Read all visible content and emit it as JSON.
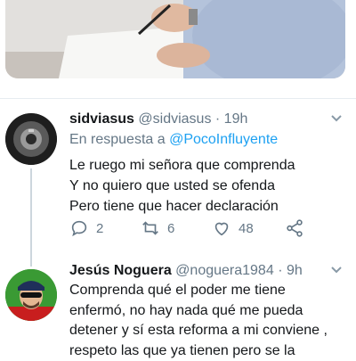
{
  "media": {
    "description_icon": "photo-icon"
  },
  "tweets": [
    {
      "name": "sidviasus",
      "handle": "@sidviasus",
      "dot": "·",
      "time": "19h",
      "reply_prefix": "En respuesta a",
      "reply_mention": "@PocoInfluyente",
      "lines": [
        "Le ruego mi señora que comprenda",
        "Y no quiero que usted se ofenda",
        "Pero tiene que hacer declaración"
      ],
      "actions": {
        "reply_count": "2",
        "retweet_count": "6",
        "like_count": "48"
      }
    },
    {
      "name": "Jesús Noguera",
      "handle": "@noguera1984",
      "dot": "·",
      "time": "9h",
      "lines": [
        "Comprenda qué el poder me tiene",
        "enfermó, no hay nada qué me pueda",
        "detener y sí esta reforma a mi conviene ,",
        "respeto las que ya tienen pero se la"
      ]
    }
  ],
  "colors": {
    "accent": "#1da1f2",
    "muted": "#657786",
    "text": "#14171a"
  }
}
